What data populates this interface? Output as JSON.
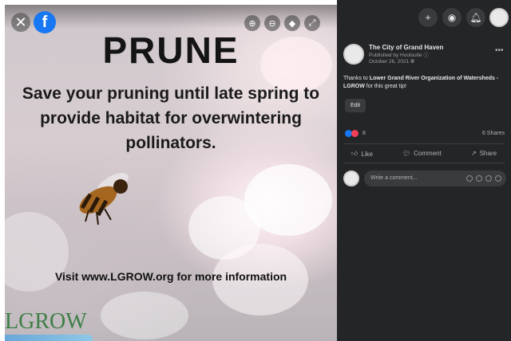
{
  "poster": {
    "title": "PRUNE",
    "body": "Save your pruning until late spring to provide habitat for overwintering pollinators.",
    "visit": "Visit www.LGROW.org for more information",
    "logo": "LGROW"
  },
  "viewer": {
    "close_icon": "close-icon",
    "brand_icon": "facebook-logo",
    "tools": [
      "zoom-in-icon",
      "zoom-out-icon",
      "tag-icon",
      "fullscreen-icon"
    ]
  },
  "header_icons": [
    "plus-icon",
    "messenger-icon",
    "notifications-icon",
    "profile-avatar"
  ],
  "post": {
    "page_name": "The City of Grand Haven",
    "published_by": "Published by Hootsuite",
    "date": "October 26, 2021",
    "text_prefix": "Thanks to ",
    "text_link": "Lower Grand River Organization of Watersheds - LGROW",
    "text_suffix": " for this great tip!",
    "edit_label": "Edit",
    "reaction_count": "8",
    "shares": "6 Shares",
    "like_label": "Like",
    "comment_label": "Comment",
    "share_label": "Share",
    "comment_placeholder": "Write a comment..."
  },
  "colors": {
    "panel_bg": "#242526",
    "facebook_blue": "#1877f2",
    "like_blue": "#1877f2",
    "love_red": "#f33e58",
    "logo_green": "#3f7f46"
  }
}
